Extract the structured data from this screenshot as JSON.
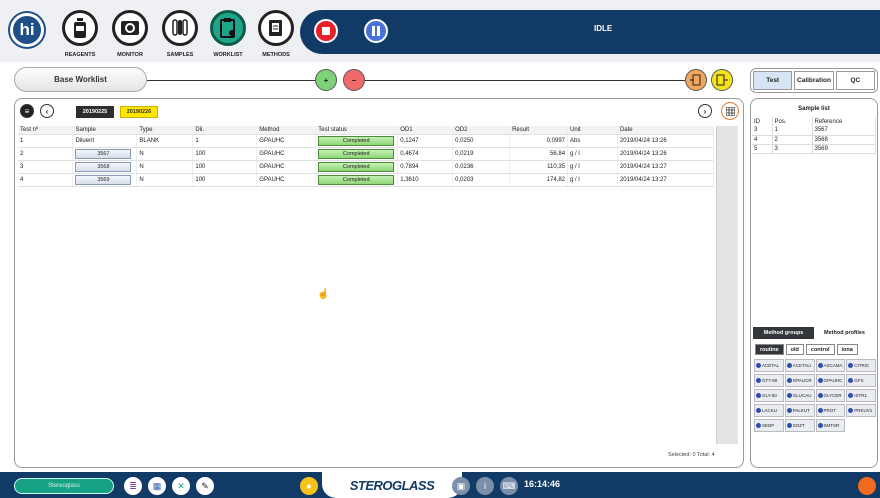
{
  "app": {
    "logo_text": "hi",
    "status": "IDLE"
  },
  "nav": [
    {
      "label": "REAGENTS",
      "icon": "reagent-bottle-icon"
    },
    {
      "label": "MONITOR",
      "icon": "monitor-icon"
    },
    {
      "label": "SAMPLES",
      "icon": "test-tubes-icon"
    },
    {
      "label": "WORKLIST",
      "icon": "clipboard-gear-icon",
      "active": true
    },
    {
      "label": "METHODS",
      "icon": "notebook-icon"
    }
  ],
  "worklist": {
    "tab_label": "Base Worklist",
    "add_btn": "+",
    "remove_btn": "−",
    "dates": [
      "20190225",
      "20190226"
    ],
    "columns": [
      "Test nº",
      "Sample",
      "Type",
      "Dil.",
      "Method",
      "Test status",
      "OD1",
      "OD2",
      "Result",
      "Unit",
      "Date"
    ],
    "rows": [
      {
        "test": "1",
        "sample": "Diluent",
        "type": "BLANK",
        "dil": "1",
        "method": "GPAUHC",
        "status": "Completed",
        "od1": "0,1247",
        "od2": "0,0250",
        "result": "0,0997",
        "unit": "Abs",
        "date": "2019/04/24  13:26"
      },
      {
        "test": "2",
        "sample": "3567",
        "type": "N",
        "dil": "100",
        "method": "GPAUHC",
        "status": "Completed",
        "od1": "0,4674",
        "od2": "0,0219",
        "result": "56,84",
        "unit": "g / l",
        "date": "2019/04/24  13:26"
      },
      {
        "test": "3",
        "sample": "3568",
        "type": "N",
        "dil": "100",
        "method": "GPAUHC",
        "status": "Completed",
        "od1": "0,7894",
        "od2": "0,0236",
        "result": "110,35",
        "unit": "g / l",
        "date": "2019/04/24  13:27"
      },
      {
        "test": "4",
        "sample": "3569",
        "type": "N",
        "dil": "100",
        "method": "GPAUHC",
        "status": "Completed",
        "od1": "1,3610",
        "od2": "0,0203",
        "result": "174,82",
        "unit": "g / l",
        "date": "2019/04/24  13:27"
      }
    ],
    "footer": "Selected: 0  Total: 4"
  },
  "right_tabs": [
    "Test",
    "Calibration",
    "QC"
  ],
  "sample_list": {
    "title": "Sample list",
    "columns": [
      "ID",
      "Pos.",
      "Reference"
    ],
    "rows": [
      {
        "id": "3",
        "pos": "1",
        "ref": "3567"
      },
      {
        "id": "4",
        "pos": "2",
        "ref": "3568"
      },
      {
        "id": "5",
        "pos": "3",
        "ref": "3569"
      }
    ]
  },
  "method_tabs": [
    "Method groups",
    "Method profiles"
  ],
  "method_subtabs": [
    "routine",
    "old",
    "control",
    "iona"
  ],
  "methods": [
    "ACETAL",
    "ACETALI",
    "ASCAMA",
    "CITRIC",
    "GT7-50",
    "GPAUCR",
    "GPAUHC",
    "GFS",
    "GLY-50",
    "GLUCAU",
    "GLYCER",
    "ISTR1",
    "LACKU",
    "PALKUT",
    "PROT",
    "PRKUV1",
    "SEDP",
    "SOZT",
    "SMTSR"
  ],
  "bottom": {
    "user": "Stereoglass",
    "brand": "STEROGLASS",
    "clock": "16:14:46"
  },
  "colors": {
    "navy": "#123a66",
    "accent_green": "#1fa58a",
    "completed_green": "#8ed676",
    "date_active": "#ffe600"
  }
}
